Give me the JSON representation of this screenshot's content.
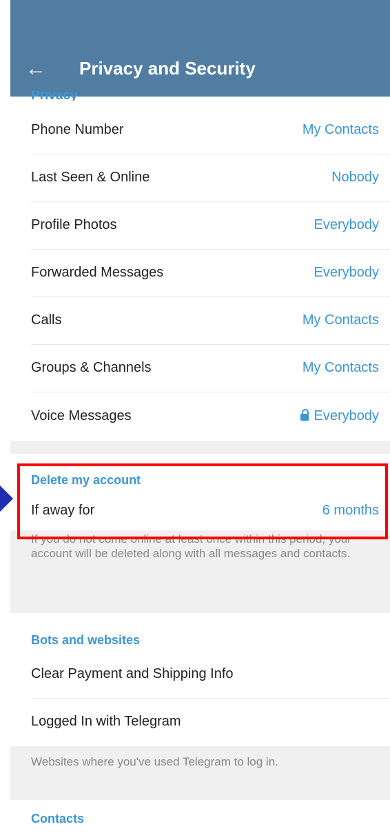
{
  "header": {
    "title": "Privacy and Security",
    "clipped_section": "Privacy"
  },
  "privacy": {
    "phone": {
      "label": "Phone Number",
      "value": "My Contacts"
    },
    "last_seen": {
      "label": "Last Seen & Online",
      "value": "Nobody"
    },
    "photos": {
      "label": "Profile Photos",
      "value": "Everybody"
    },
    "forwarded": {
      "label": "Forwarded Messages",
      "value": "Everybody"
    },
    "calls": {
      "label": "Calls",
      "value": "My Contacts"
    },
    "groups": {
      "label": "Groups & Channels",
      "value": "My Contacts"
    },
    "voice": {
      "label": "Voice Messages",
      "value": "Everybody",
      "icon": "lock-icon"
    }
  },
  "delete_account": {
    "header": "Delete my account",
    "label": "If away for",
    "value": "6 months",
    "hint": "If you do not come online at least once within this period, your account will be deleted along with all messages and contacts."
  },
  "bots": {
    "header": "Bots and websites",
    "clear_payment": "Clear Payment and Shipping Info",
    "logged_in": "Logged In with Telegram",
    "hint": "Websites where you've used Telegram to log in."
  },
  "contacts": {
    "header": "Contacts"
  },
  "colors": {
    "toolbar": "#517da2",
    "accent": "#3a95d5",
    "highlight": "#ff0000",
    "arrow": "#1f2fb2"
  }
}
